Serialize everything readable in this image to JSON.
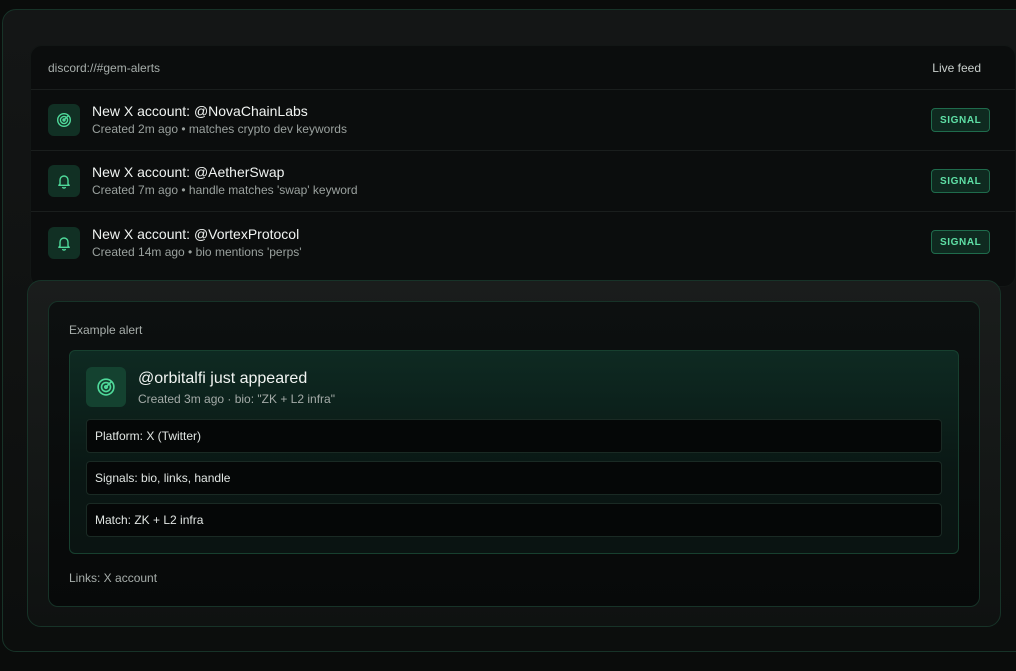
{
  "feed": {
    "channel": "discord://#gem-alerts",
    "status": "Live feed",
    "items": [
      {
        "icon": "radar-icon",
        "title": "New X account: @NovaChainLabs",
        "subtitle": "Created 2m ago • matches crypto dev keywords",
        "badge": "SIGNAL"
      },
      {
        "icon": "bell-icon",
        "title": "New X account: @AetherSwap",
        "subtitle": "Created 7m ago • handle matches 'swap' keyword",
        "badge": "SIGNAL"
      },
      {
        "icon": "bell-icon",
        "title": "New X account: @VortexProtocol",
        "subtitle": "Created 14m ago • bio mentions 'perps'",
        "badge": "SIGNAL"
      }
    ]
  },
  "example": {
    "label": "Example alert",
    "icon": "radar-icon",
    "title": "@orbitalfi just appeared",
    "subtitle": "Created 3m ago · bio: \"ZK + L2 infra\"",
    "fields": [
      "Platform: X (Twitter)",
      "Signals: bio, links, handle",
      "Match: ZK + L2 infra"
    ],
    "links": "Links: X account"
  },
  "colors": {
    "accent": "#5fe0a6",
    "badge_border": "#1f6b4c",
    "background": "#0a0c0b"
  }
}
